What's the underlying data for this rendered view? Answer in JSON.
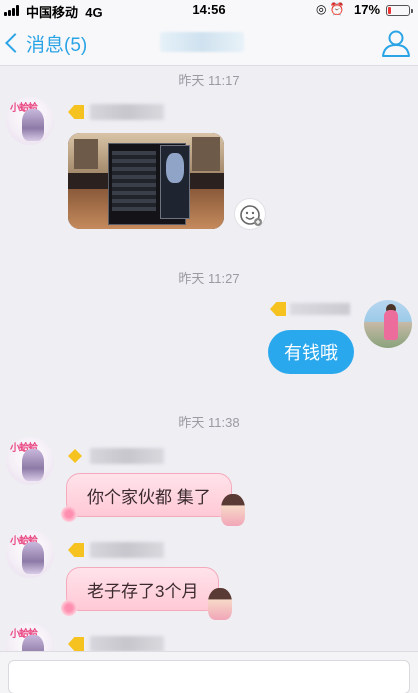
{
  "status_bar": {
    "carrier": "中国移动",
    "network": "4G",
    "time": "14:56",
    "battery_percent": "17%",
    "battery_level": 0.17,
    "icons": [
      "signal-icon",
      "orientation-lock-icon",
      "alarm-icon",
      "battery-icon"
    ]
  },
  "nav": {
    "back_label": "消息(5)",
    "right_icon": "profile-icon"
  },
  "messages": [
    {
      "time": "昨天 11:17"
    },
    {
      "time": "昨天 11:27",
      "text": "有钱哦"
    },
    {
      "time": "昨天 11:38",
      "text": "你个家伙都  集了"
    },
    {
      "text": "老子存了3个月"
    }
  ],
  "avatar_left_label": "小蛤蛤",
  "colors": {
    "accent": "#2ba4e6",
    "outgoing_bubble": "#2aa8ee",
    "incoming_bubble": "#ffc9d6",
    "badge_yellow": "#f6c220",
    "background": "#eeeef3"
  }
}
